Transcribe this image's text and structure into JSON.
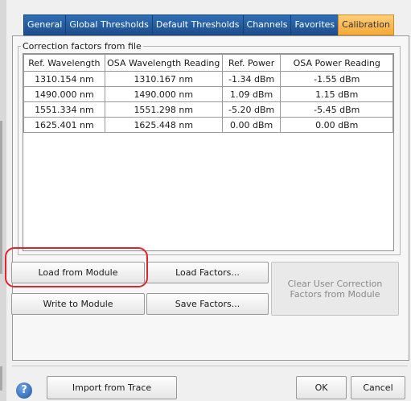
{
  "tabs": [
    "General",
    "Global Thresholds",
    "Default Thresholds",
    "Channels",
    "Favorites",
    "Calibration"
  ],
  "active_tab": "Calibration",
  "group_label": "Correction factors from file",
  "table": {
    "headers": [
      "Ref. Wavelength",
      "OSA Wavelength Reading",
      "Ref. Power",
      "OSA Power Reading"
    ],
    "rows": [
      [
        "1310.154 nm",
        "1310.167 nm",
        "-1.34 dBm",
        "-1.55 dBm"
      ],
      [
        "1490.000 nm",
        "1490.000 nm",
        "1.09 dBm",
        "1.15 dBm"
      ],
      [
        "1551.334 nm",
        "1551.298 nm",
        "-5.20 dBm",
        "-5.45 dBm"
      ],
      [
        "1625.401 nm",
        "1625.448 nm",
        "0.00 dBm",
        "0.00 dBm"
      ]
    ]
  },
  "buttons": {
    "load_from_module": "Load from Module",
    "load_factors": "Load Factors...",
    "clear_user": "Clear User Correction Factors from Module",
    "write_to_module": "Write to Module",
    "save_factors": "Save Factors...",
    "import_from_trace": "Import from Trace",
    "ok": "OK",
    "cancel": "Cancel"
  },
  "help_glyph": "?",
  "colors": {
    "tab_blue": "#2563a8",
    "tab_active": "#f7b04a",
    "highlight": "#e0242e"
  }
}
